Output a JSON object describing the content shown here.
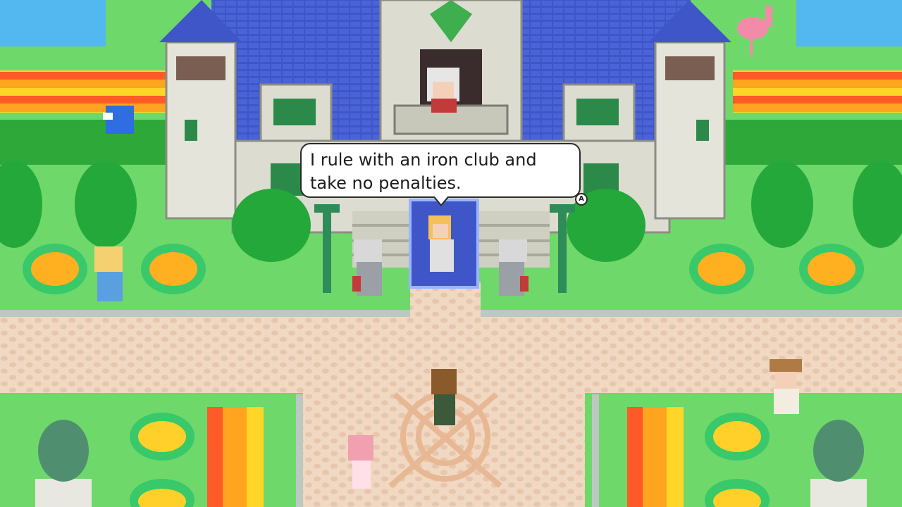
{
  "dialog": {
    "line1": "I rule with an iron club and",
    "line2": "take no penalties.",
    "continue_button": "A"
  },
  "colors": {
    "grass": "#6fd86a",
    "path": "#f1d8c2",
    "castle_roof": "#3f56c8",
    "castle_wall": "#dcdcd0",
    "water": "#54b8f0",
    "hedge": "#2fa83a"
  },
  "icons": [
    "castle",
    "queen-npc",
    "knight-guard",
    "player-character",
    "golf-clubs-emblem",
    "statue",
    "tree",
    "flower-bed",
    "bird",
    "flamingo"
  ]
}
